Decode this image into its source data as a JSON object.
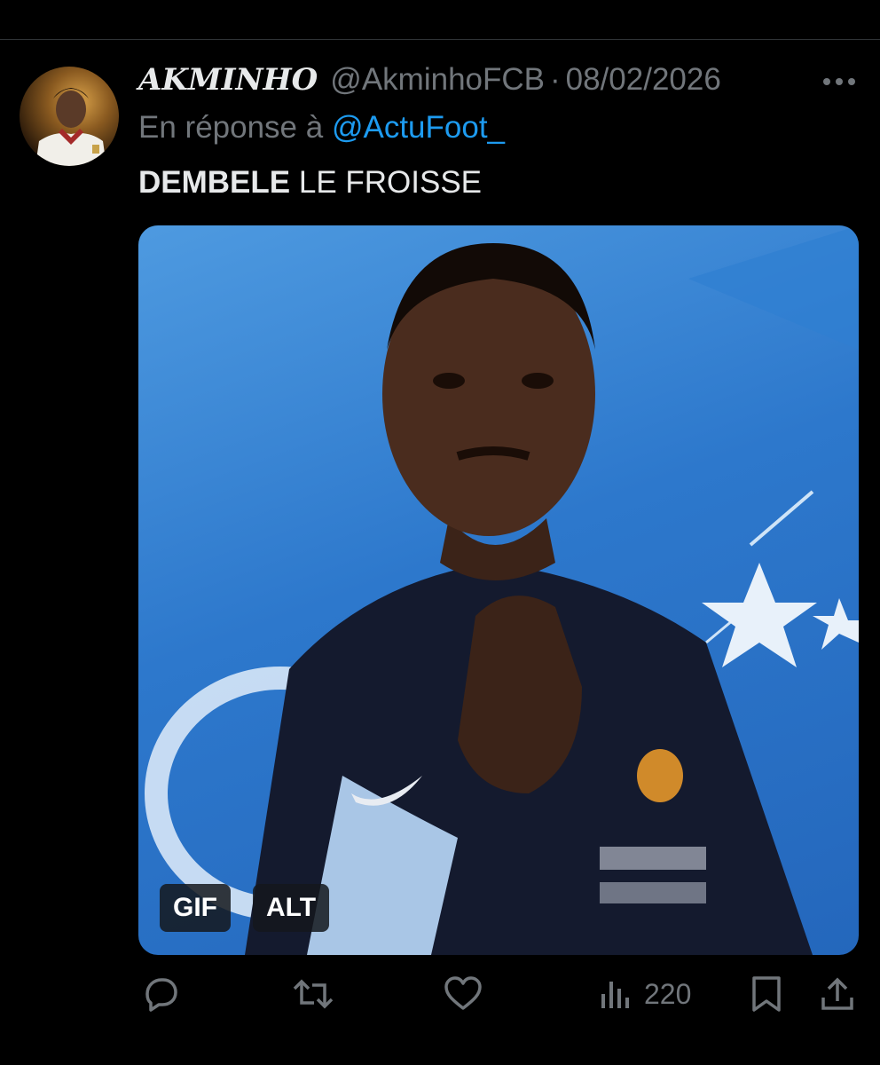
{
  "tweet": {
    "display_name": "AKMINHO",
    "handle": "@AkminhoFCB",
    "separator": "·",
    "date": "08/02/2026",
    "reply_prefix": "En réponse à",
    "reply_to": "@ActuFoot_",
    "text_bold": "DEMBELE",
    "text_rest": " LE FROISSE"
  },
  "media": {
    "gif_badge": "GIF",
    "alt_badge": "ALT"
  },
  "actions": {
    "reply_icon": "reply-icon",
    "retweet_icon": "retweet-icon",
    "like_icon": "heart-icon",
    "views_icon": "views-icon",
    "views_count": "220",
    "bookmark_icon": "bookmark-icon",
    "share_icon": "share-icon"
  },
  "colors": {
    "background": "#000000",
    "text": "#e7e9ea",
    "muted": "#71767b",
    "link": "#1d9bf0"
  }
}
